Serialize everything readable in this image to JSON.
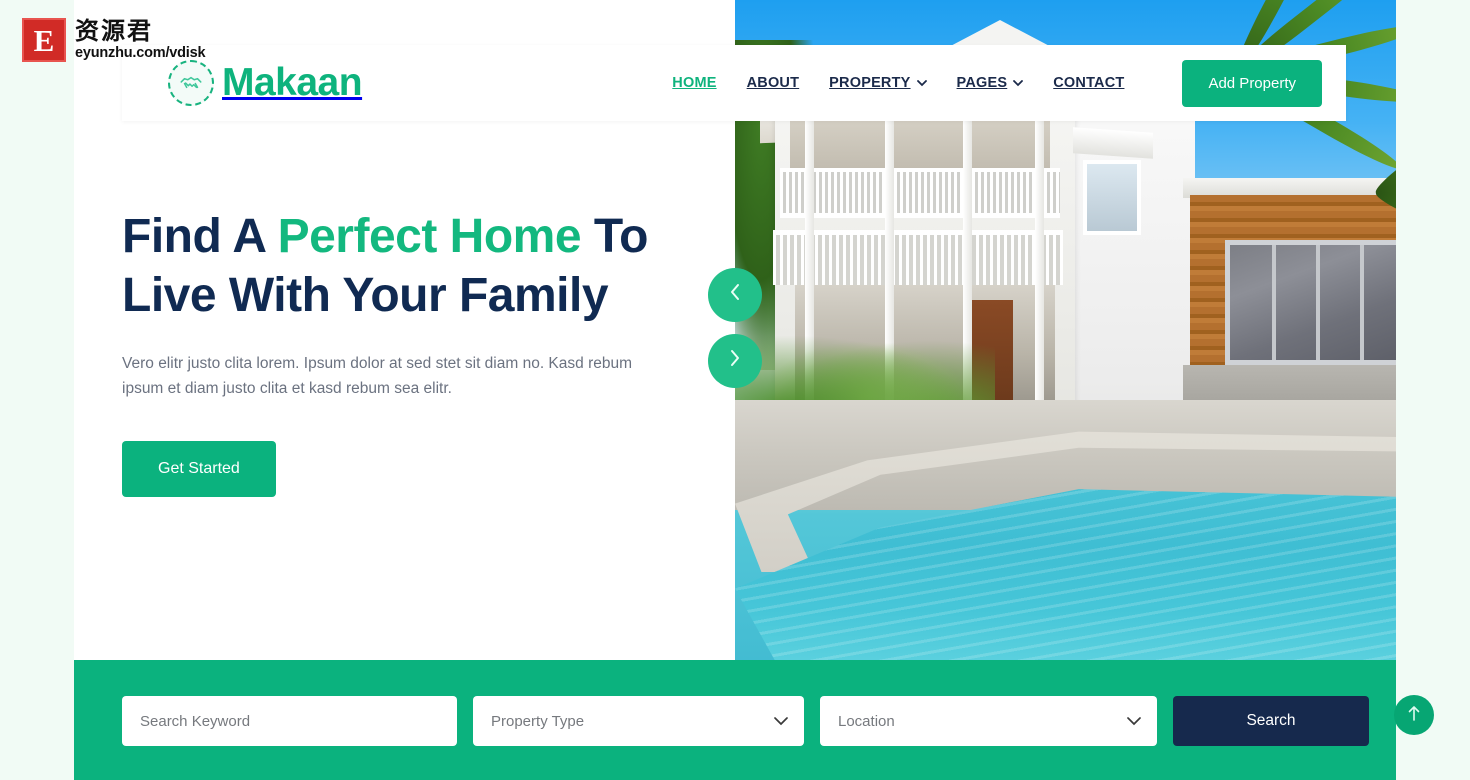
{
  "brand": {
    "name": "Makaan",
    "mark_icon": "handshake-icon"
  },
  "nav": {
    "items": [
      {
        "label": "HOME",
        "active": true,
        "has_dropdown": false
      },
      {
        "label": "ABOUT",
        "active": false,
        "has_dropdown": false
      },
      {
        "label": "PROPERTY",
        "active": false,
        "has_dropdown": true
      },
      {
        "label": "PAGES",
        "active": false,
        "has_dropdown": true
      },
      {
        "label": "CONTACT",
        "active": false,
        "has_dropdown": false
      }
    ],
    "cta_label": "Add Property",
    "dropdown_icon": "chevron-down-icon"
  },
  "hero": {
    "title_part1": "Find A ",
    "title_accent": "Perfect Home",
    "title_part2": " To Live With Your Family",
    "description": "Vero elitr justo clita lorem. Ipsum dolor at sed stet sit diam no. Kasd rebum ipsum et diam justo clita et kasd rebum sea elitr.",
    "cta_label": "Get Started",
    "image_alt": "Two-storey white Queenslander house with veranda, timber-clad extension and turquoise swimming pool",
    "carousel": {
      "prev_icon": "chevron-left-icon",
      "prev_glyph": "‹",
      "next_icon": "chevron-right-icon",
      "next_glyph": "›"
    }
  },
  "search": {
    "keyword_placeholder": "Search Keyword",
    "property_type_label": "Property Type",
    "location_label": "Location",
    "submit_label": "Search",
    "chevron_glyph": "⌄"
  },
  "back_to_top": {
    "icon": "arrow-up-icon",
    "glyph": "↑"
  },
  "watermark": {
    "logo_letter": "E",
    "cn_text": "资源君",
    "url": "eyunzhu.com/vdisk"
  },
  "colors": {
    "brand_green": "#0eb37d",
    "accent_green": "#13b87f",
    "button_green": "#0bb27e",
    "dark_navy": "#16294d",
    "heading_navy": "#102a52",
    "body_gray": "#6b7280",
    "page_bg": "#f1fbf5"
  }
}
